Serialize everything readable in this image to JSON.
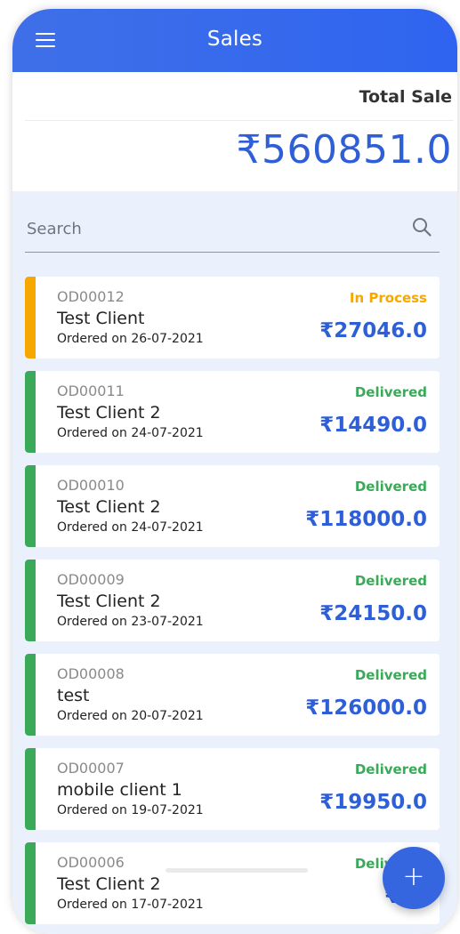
{
  "appbar": {
    "title": "Sales",
    "menu_icon": "hamburger-menu-icon"
  },
  "summary": {
    "label": "Total Sale",
    "value": "₹560851.0"
  },
  "search": {
    "placeholder": "Search",
    "value": "",
    "icon": "search-icon"
  },
  "colors": {
    "primary": "#3566e0",
    "in_process": "#f7a800",
    "delivered": "#3aa958",
    "list_background": "#eaf1fd"
  },
  "orders": [
    {
      "id": "OD00012",
      "client": "Test Client",
      "date_text": "Ordered on 26-07-2021",
      "status": "In Process",
      "amount": "₹27046.0"
    },
    {
      "id": "OD00011",
      "client": "Test Client 2",
      "date_text": "Ordered on 24-07-2021",
      "status": "Delivered",
      "amount": "₹14490.0"
    },
    {
      "id": "OD00010",
      "client": "Test Client 2",
      "date_text": "Ordered on 24-07-2021",
      "status": "Delivered",
      "amount": "₹118000.0"
    },
    {
      "id": "OD00009",
      "client": "Test Client 2",
      "date_text": "Ordered on 23-07-2021",
      "status": "Delivered",
      "amount": "₹24150.0"
    },
    {
      "id": "OD00008",
      "client": "test",
      "date_text": "Ordered on 20-07-2021",
      "status": "Delivered",
      "amount": "₹126000.0"
    },
    {
      "id": "OD00007",
      "client": "mobile client 1",
      "date_text": "Ordered on 19-07-2021",
      "status": "Delivered",
      "amount": "₹19950.0"
    },
    {
      "id": "OD00006",
      "client": "Test Client 2",
      "date_text": "Ordered on 17-07-2021",
      "status": "Delivered",
      "amount": "₹72"
    }
  ],
  "fab": {
    "label": "+",
    "icon": "plus-icon"
  }
}
